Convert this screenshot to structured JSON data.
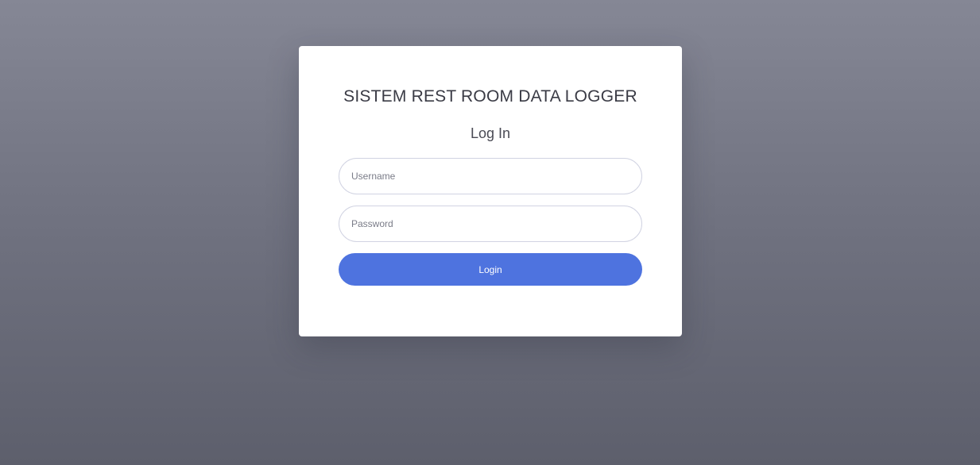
{
  "login_card": {
    "app_title": "SISTEM REST ROOM DATA LOGGER",
    "form_title": "Log In",
    "username": {
      "value": "",
      "placeholder": "Username"
    },
    "password": {
      "value": "",
      "placeholder": "Password"
    },
    "login_label": "Login"
  },
  "colors": {
    "background_top": "#858795",
    "background_bottom": "#5d5f6c",
    "card": "#ffffff",
    "button": "#4e73df",
    "field_border": "#d1d3e2"
  }
}
